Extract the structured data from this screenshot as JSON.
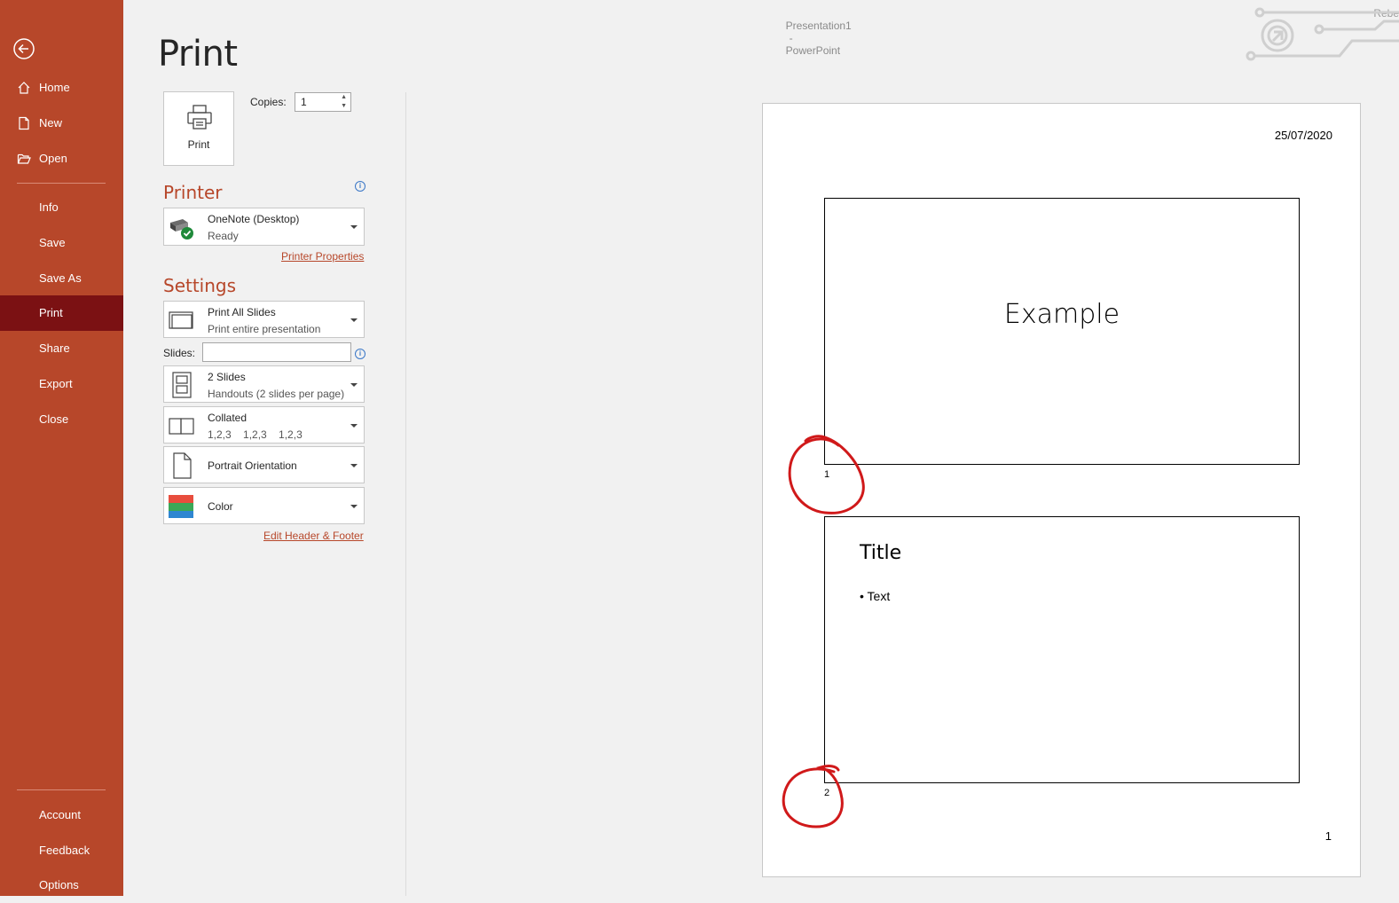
{
  "window": {
    "doc_name": "Presentation1",
    "separator": "-",
    "app_name": "PowerPoint",
    "user": "Rebe"
  },
  "sidebar": {
    "items_top": [
      {
        "label": "Home",
        "icon": "home-icon"
      },
      {
        "label": "New",
        "icon": "new-document-icon"
      },
      {
        "label": "Open",
        "icon": "open-folder-icon"
      }
    ],
    "items_mid": [
      {
        "label": "Info"
      },
      {
        "label": "Save"
      },
      {
        "label": "Save As"
      },
      {
        "label": "Print",
        "active": true
      },
      {
        "label": "Share"
      },
      {
        "label": "Export"
      },
      {
        "label": "Close"
      }
    ],
    "items_bottom": [
      {
        "label": "Account"
      },
      {
        "label": "Feedback"
      },
      {
        "label": "Options"
      }
    ]
  },
  "print": {
    "heading": "Print",
    "button_label": "Print",
    "copies_label": "Copies:",
    "copies_value": "1"
  },
  "printer": {
    "section_title": "Printer",
    "name": "OneNote (Desktop)",
    "status": "Ready",
    "properties_link": "Printer Properties"
  },
  "settings": {
    "section_title": "Settings",
    "range": {
      "title": "Print All Slides",
      "subtitle": "Print entire presentation"
    },
    "slides_label": "Slides:",
    "slides_value": "",
    "layout": {
      "title": "2 Slides",
      "subtitle": "Handouts (2 slides per page)"
    },
    "collation": {
      "title": "Collated",
      "subtitle": "1,2,3    1,2,3    1,2,3"
    },
    "orientation": {
      "title": "Portrait Orientation"
    },
    "color": {
      "title": "Color"
    },
    "header_footer_link": "Edit Header & Footer"
  },
  "preview": {
    "date": "25/07/2020",
    "slides": [
      {
        "number": "1",
        "title": "Example"
      },
      {
        "number": "2",
        "title": "Title",
        "bullet": "• Text"
      }
    ],
    "page_number": "1"
  },
  "colors": {
    "accent": "#b7472a",
    "sidebar_active": "#7b1113",
    "annotation": "#d0191a"
  }
}
